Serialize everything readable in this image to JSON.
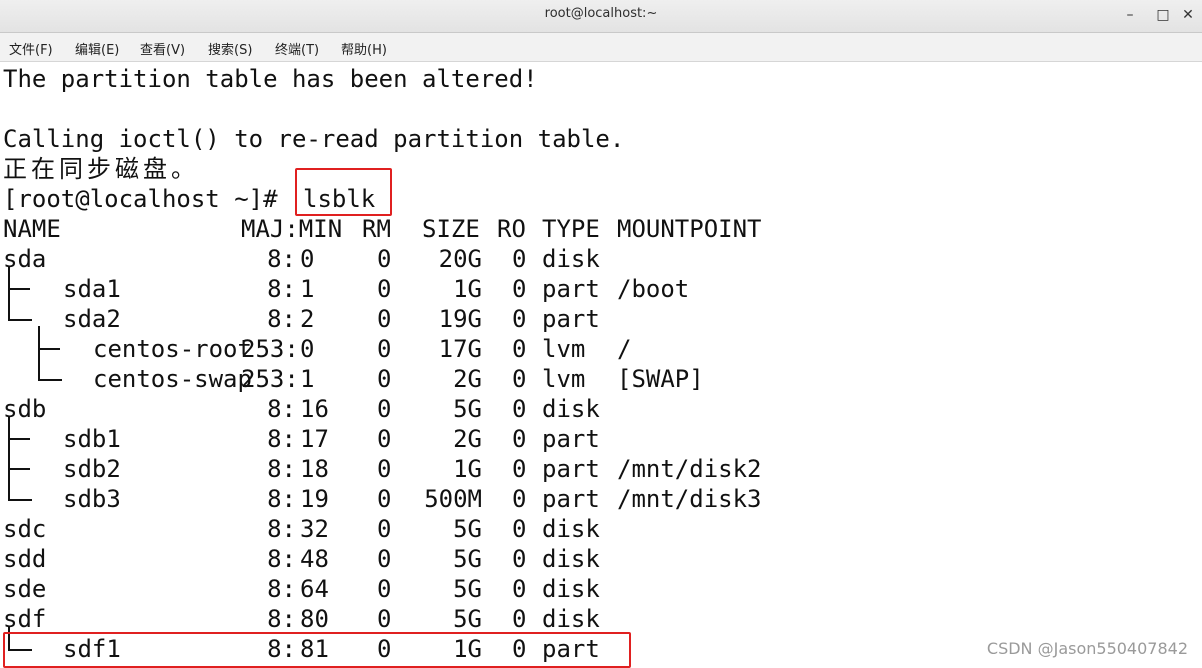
{
  "window": {
    "title": "root@localhost:~",
    "minimize_glyph": "–",
    "maximize_glyph": "□",
    "close_glyph": "✕"
  },
  "menu": [
    "文件(F)",
    "编辑(E)",
    "查看(V)",
    "搜索(S)",
    "终端(T)",
    "帮助(H)"
  ],
  "terminal": {
    "pre_lines": [
      "The partition table has been altered!",
      "",
      "Calling ioctl() to re-read partition table.",
      "正在同步磁盘。"
    ],
    "prompt": "[root@localhost ~]#",
    "command": "lsblk",
    "headers": {
      "name": "NAME",
      "majmin": "MAJ:MIN",
      "rm": "RM",
      "size": "SIZE",
      "ro": "RO",
      "type": "TYPE",
      "mountpoint": "MOUNTPOINT"
    },
    "rows": [
      {
        "name": "sda",
        "majmin": "8:0",
        "rm": "0",
        "size": "20G",
        "ro": "0",
        "type": "disk",
        "mountpoint": ""
      },
      {
        "name": "sda1",
        "majmin": "8:1",
        "rm": "0",
        "size": "1G",
        "ro": "0",
        "type": "part",
        "mountpoint": "/boot"
      },
      {
        "name": "sda2",
        "majmin": "8:2",
        "rm": "0",
        "size": "19G",
        "ro": "0",
        "type": "part",
        "mountpoint": ""
      },
      {
        "name": "centos-root",
        "majmin": "253:0",
        "rm": "0",
        "size": "17G",
        "ro": "0",
        "type": "lvm",
        "mountpoint": "/"
      },
      {
        "name": "centos-swap",
        "majmin": "253:1",
        "rm": "0",
        "size": "2G",
        "ro": "0",
        "type": "lvm",
        "mountpoint": "[SWAP]"
      },
      {
        "name": "sdb",
        "majmin": "8:16",
        "rm": "0",
        "size": "5G",
        "ro": "0",
        "type": "disk",
        "mountpoint": ""
      },
      {
        "name": "sdb1",
        "majmin": "8:17",
        "rm": "0",
        "size": "2G",
        "ro": "0",
        "type": "part",
        "mountpoint": ""
      },
      {
        "name": "sdb2",
        "majmin": "8:18",
        "rm": "0",
        "size": "1G",
        "ro": "0",
        "type": "part",
        "mountpoint": "/mnt/disk2"
      },
      {
        "name": "sdb3",
        "majmin": "8:19",
        "rm": "0",
        "size": "500M",
        "ro": "0",
        "type": "part",
        "mountpoint": "/mnt/disk3"
      },
      {
        "name": "sdc",
        "majmin": "8:32",
        "rm": "0",
        "size": "5G",
        "ro": "0",
        "type": "disk",
        "mountpoint": ""
      },
      {
        "name": "sdd",
        "majmin": "8:48",
        "rm": "0",
        "size": "5G",
        "ro": "0",
        "type": "disk",
        "mountpoint": ""
      },
      {
        "name": "sde",
        "majmin": "8:64",
        "rm": "0",
        "size": "5G",
        "ro": "0",
        "type": "disk",
        "mountpoint": ""
      },
      {
        "name": "sdf",
        "majmin": "8:80",
        "rm": "0",
        "size": "5G",
        "ro": "0",
        "type": "disk",
        "mountpoint": ""
      },
      {
        "name": "sdf1",
        "majmin": "8:81",
        "rm": "0",
        "size": "1G",
        "ro": "0",
        "type": "part",
        "mountpoint": ""
      }
    ]
  },
  "highlight_color": "#e02020",
  "watermark": "CSDN @Jason550407842"
}
